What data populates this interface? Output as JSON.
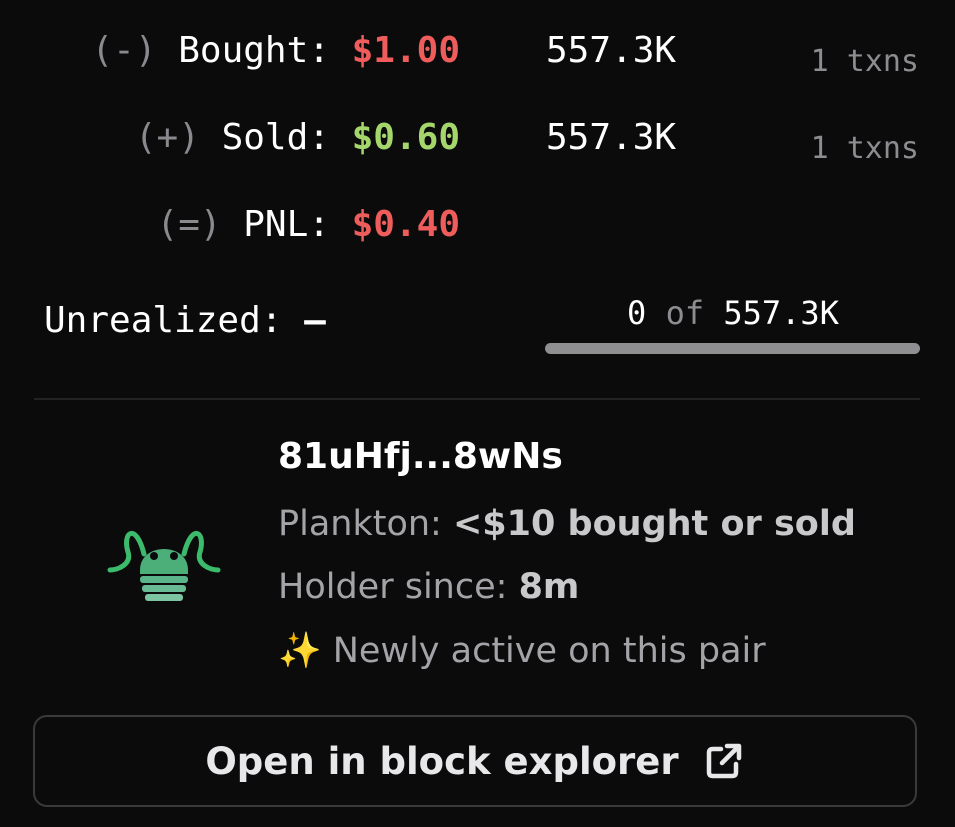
{
  "trades": {
    "bought": {
      "sign": "(-)",
      "label": "Bought:",
      "amount": "$1.00",
      "qty": "557.3K",
      "txns": "1 txns"
    },
    "sold": {
      "sign": "(+)",
      "label": "Sold:",
      "amount": "$0.60",
      "qty": "557.3K",
      "txns": "1 txns"
    },
    "pnl": {
      "sign": "(=)",
      "label": "PNL:",
      "amount": "$0.40"
    }
  },
  "unrealized": {
    "label": "Unrealized:",
    "value": "–",
    "held": "0",
    "of": "of",
    "total": "557.3K",
    "progress_fraction": 0.0
  },
  "trader": {
    "address": "81uHfj...8wNs",
    "tier_label": "Plankton:",
    "tier_value": "<$10 bought or sold",
    "holder_label": "Holder since:",
    "holder_value": "8m",
    "badge_emoji": "✨",
    "badge_text": "Newly active on this pair",
    "avatar_icon": "plankton-icon"
  },
  "actions": {
    "explorer_label": "Open in block explorer",
    "explorer_icon": "external-link-icon"
  },
  "colors": {
    "negative": "#ee5c5c",
    "positive": "#a5d66b",
    "avatar": "#3dbb6c"
  }
}
